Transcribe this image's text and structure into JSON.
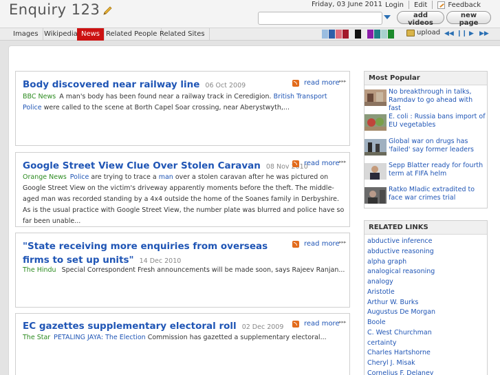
{
  "header": {
    "logo": "Enquiry 123",
    "date": "Friday, 03 June 2011",
    "login": "Login",
    "edit": "Edit",
    "feedback": "Feedback",
    "search_value": "",
    "add_videos": "add videos",
    "new_page": "new page"
  },
  "tabs": [
    "Images",
    "Wikipedia",
    "News",
    "Related People",
    "Related Sites"
  ],
  "active_tab": "News",
  "toolbar": {
    "upload": "upload",
    "swatch_colors": [
      "#9bbde0",
      "#2f5fa8",
      "#e06c7a",
      "#a3192b",
      "#111111",
      "#8a1ea8",
      "#1f7f86",
      "#a8d1cf",
      "#1b8a2c"
    ],
    "accent": "#cc1212"
  },
  "news": [
    {
      "title": "Body discovered near railway line",
      "date": "06 Oct 2009",
      "read_more": "read more",
      "source": "BBC News",
      "body_1": "A man's body has been found near a railway track in Ceredigion.",
      "kw_1": "British Transport Police",
      "body_2": "were called to the scene at Borth Capel Soar crossing, near Aberystwyth,..."
    },
    {
      "title": "Google Street View Clue Over Stolen Caravan",
      "date": "08 Nov 2010",
      "read_more": "read more",
      "source": "Orange News",
      "kw_1": "Police",
      "body_1": "are trying to trace a",
      "kw_2": "man",
      "body_2": "over a stolen caravan after he was pictured on Google Street View on the victim's driveway apparently moments before the theft. The middle-aged man was recorded standing by a 4x4 outside the home of the Soanes family in Derbyshire. As is the usual practice with Google Street View, the number plate was blurred and police have so far been unable..."
    },
    {
      "title": "\"State receiving more enquiries from overseas firms to set up units\"",
      "date": "14 Dec 2010",
      "read_more": "read more",
      "source": "The Hindu",
      "body_1": "Special Correspondent Fresh announcements will be made soon, says Rajeev Ranjan..."
    },
    {
      "title": "EC gazettes supplementary electoral roll",
      "date": "02 Dec 2009",
      "read_more": "read more",
      "source": "The Star",
      "body_1": "PETALING JAYA: The",
      "kw_1": "Election",
      "body_2": "Commission has gazetted a supplementary electoral..."
    }
  ],
  "most_popular": {
    "heading": "Most Popular",
    "items": [
      "No breakthrough in talks, Ramdav to go ahead with fast",
      "E. coli : Russia bans import of EU vegetables",
      "Global war on drugs has 'failed' say former leaders",
      "Sepp Blatter ready for fourth term at FIFA helm",
      "Ratko Mladic extradited to face war crimes trial"
    ]
  },
  "related_links": {
    "heading": "RELATED LINKS",
    "items": [
      "abductive inference",
      "abductive reasoning",
      "alpha graph",
      "analogical reasoning",
      "analogy",
      "Aristotle",
      "Arthur W. Burks",
      "Augustus De Morgan",
      "Boole",
      "C. West Churchman",
      "certainty",
      "Charles Hartshorne",
      "Cheryl J. Misak",
      "Cornelius F. Delaney"
    ]
  }
}
